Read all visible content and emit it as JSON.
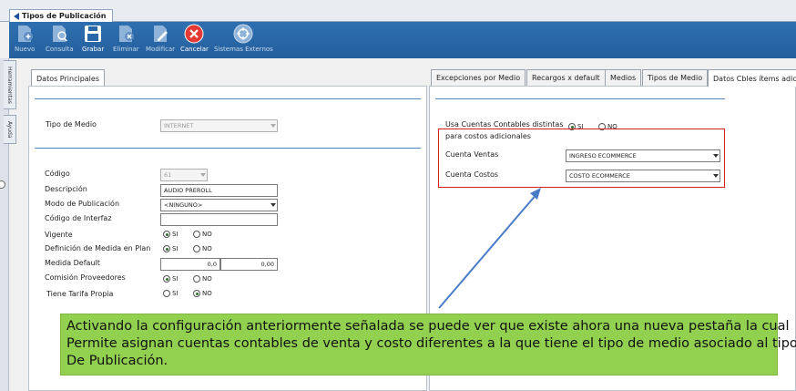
{
  "window": {
    "tab_title": "Tipos de Publicación"
  },
  "toolbar": {
    "buttons": [
      {
        "label": "Nuevo",
        "enabled": false
      },
      {
        "label": "Consulta",
        "enabled": false
      },
      {
        "label": "Grabar",
        "enabled": true
      },
      {
        "label": "Eliminar",
        "enabled": false
      },
      {
        "label": "Modificar",
        "enabled": false
      },
      {
        "label": "Cancelar",
        "enabled": true
      },
      {
        "label": "Sistemas Externos",
        "enabled": false
      }
    ]
  },
  "side_tabs": [
    "Herramientas",
    "Ayuda"
  ],
  "left_panel": {
    "tab": "Datos Principales",
    "tipo_medio": {
      "label": "Tipo de Medio",
      "value": "INTERNET"
    },
    "codigo": {
      "label": "Código",
      "value": "61"
    },
    "descripcion": {
      "label": "Descripción",
      "value": "AUDIO PREROLL"
    },
    "modo_publicacion": {
      "label": "Modo de Publicación",
      "value": "<NINGUNO>"
    },
    "codigo_interfaz": {
      "label": "Código de Interfaz",
      "value": ""
    },
    "vigente": {
      "label": "Vigente"
    },
    "definicion_medida": {
      "label": "Definición de Medida en Plan"
    },
    "medida_default": {
      "label": "Medida Default",
      "value1": "0,0",
      "value2": "0,00"
    },
    "comision_proveedores": {
      "label": "Comisión Proveedores"
    },
    "tiene_tarifa": {
      "label": "Tiene Tarifa Propia"
    },
    "radio_si": "SI",
    "radio_no": "NO"
  },
  "right_panel": {
    "tabs": [
      "Excepciones por Medio",
      "Recargos x default",
      "Medios",
      "Tipos de Medio",
      "Datos Cbles ítems adic"
    ],
    "usa_cuentas": {
      "label_line1": "Usa Cuentas Contables distintas",
      "label_line2": "para costos adicionales",
      "si": "SI",
      "no": "NO"
    },
    "cuenta_ventas": {
      "label": "Cuenta Ventas",
      "value": "INGRESO ECOMMERCE"
    },
    "cuenta_costos": {
      "label": "Cuenta Costos",
      "value": "COSTO ECOMMERCE"
    }
  },
  "note": {
    "line1": "Activando la configuración anteriormente señalada se puede ver que existe ahora una nueva pestaña la cual",
    "line2": "Permite asignan cuentas contables de venta y costo diferentes a la que tiene el tipo de medio asociado al tipo",
    "line3": "De Publicación."
  },
  "colors": {
    "toolbar": "#2a67a8",
    "highlight_box": "#d61f1f",
    "note_bg": "#92d050",
    "arrow": "#4a7cc7"
  }
}
